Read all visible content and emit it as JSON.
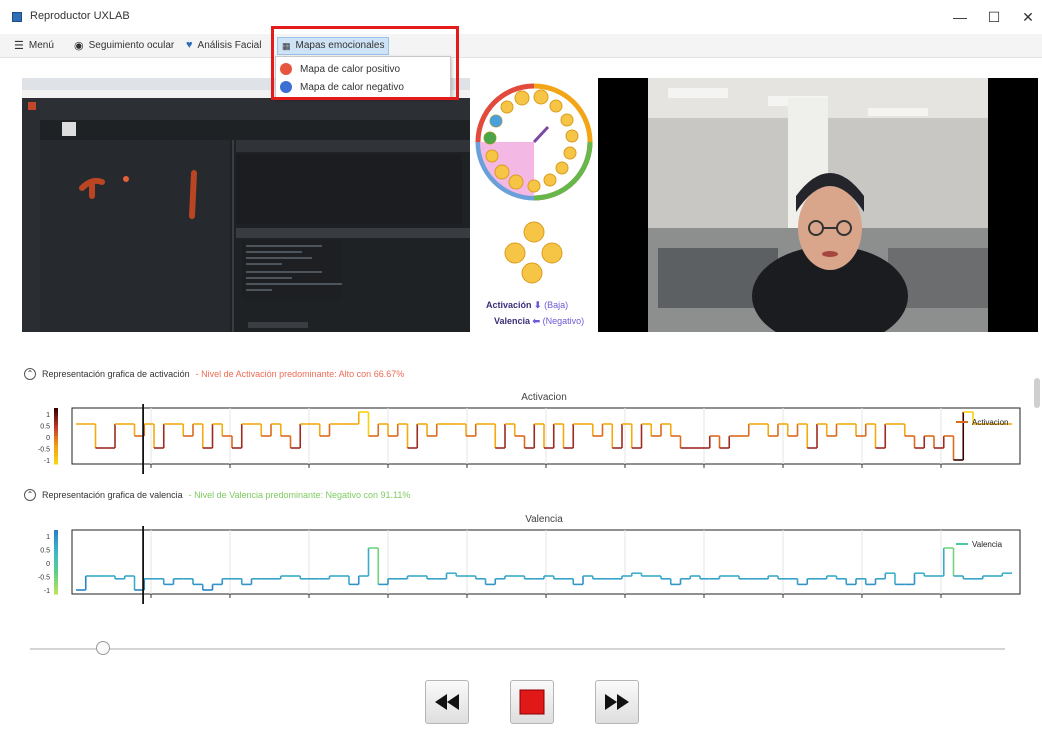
{
  "window": {
    "title": "Reproductor UXLAB",
    "minimize": "—",
    "maximize": "☐",
    "close": "✕"
  },
  "menu": {
    "items": [
      {
        "label": "Menú",
        "icon": "hamburger-icon"
      },
      {
        "label": "Seguimiento ocular",
        "icon": "eye-tracking-icon"
      },
      {
        "label": "Análisis Facial",
        "icon": "heart-icon"
      },
      {
        "label": "Mapas emocionales",
        "icon": "map-grid-icon"
      }
    ],
    "dropdown": [
      {
        "label": "Mapa de calor positivo",
        "color": "#e8553f"
      },
      {
        "label": "Mapa de calor negativo",
        "color": "#3b6fd4"
      }
    ]
  },
  "wheel": {
    "activation_label": "Activación",
    "activation_value": "(Baja)",
    "valence_label": "Valencia",
    "valence_value": "(Negativo)"
  },
  "sections": {
    "activation": {
      "heading": "Representación grafica de activación",
      "subtitle": "- Nivel de Activación predominante: Alto con 66.67%"
    },
    "valence": {
      "heading": "Representación grafica de valencia",
      "subtitle": "- Nivel de Valencia predominante: Negativo con 91.11%"
    }
  },
  "chart_data": [
    {
      "type": "line",
      "title": "Activacion",
      "legend": "Activacion",
      "legend_position": "right",
      "yticks": [
        "1",
        "0.5",
        "0",
        "-0.5",
        "-1"
      ],
      "ylim": [
        -1,
        1
      ],
      "colormap": [
        "#3b0000",
        "#c0392b",
        "#f39c12",
        "#f6d30f"
      ],
      "values": [
        0.5,
        0.5,
        -0.5,
        -0.5,
        0.5,
        0.5,
        0.0,
        0.5,
        -0.5,
        0.5,
        0.5,
        0.0,
        0.5,
        -0.5,
        0.5,
        0.0,
        -0.5,
        0.5,
        0.5,
        0.0,
        0.5,
        0.0,
        -0.5,
        0.5,
        0.5,
        0.0,
        0.5,
        0.5,
        0.5,
        1.0,
        0.0,
        0.5,
        0.0,
        0.5,
        -0.5,
        0.5,
        0.0,
        0.5,
        0.5,
        0.5,
        0.0,
        0.5,
        0.5,
        -0.5,
        0.5,
        0.0,
        -0.5,
        0.5,
        -0.5,
        0.5,
        -0.5,
        0.5,
        0.5,
        0.0,
        0.5,
        -0.5,
        0.5,
        -0.5,
        0.5,
        0.0,
        0.5,
        0.0,
        -0.5,
        -0.5,
        -0.5,
        0.0,
        -0.5,
        0.0,
        0.0,
        0.5,
        0.5,
        0.0,
        0.5,
        0.0,
        0.5,
        -0.5,
        0.5,
        0.0,
        0.5,
        0.5,
        0.0,
        0.5,
        -0.5,
        0.5,
        0.5,
        0.0,
        -0.5,
        0.0,
        -0.5,
        0.0,
        -1.0,
        1.0,
        0.5,
        0.5,
        0.5,
        0.5
      ]
    },
    {
      "type": "line",
      "title": "Valencia",
      "legend": "Valencia",
      "legend_position": "right",
      "yticks": [
        "1",
        "0.5",
        "0",
        "-0.5",
        "-1"
      ],
      "ylim": [
        -1,
        1
      ],
      "colormap": [
        "#2b83c6",
        "#3fb7c9",
        "#59d08a",
        "#b6e35a"
      ],
      "values": [
        -1.0,
        -0.5,
        -0.5,
        -0.5,
        -0.6,
        -0.5,
        -1.0,
        -0.6,
        -0.6,
        -0.8,
        -0.6,
        -0.6,
        -0.8,
        -1.0,
        -0.8,
        -0.6,
        -0.6,
        -0.8,
        -0.6,
        -0.6,
        -0.6,
        -0.5,
        -0.5,
        -0.6,
        -0.6,
        -0.6,
        -0.5,
        -0.5,
        -0.8,
        -0.5,
        0.5,
        -0.8,
        -0.6,
        -0.6,
        -0.5,
        -0.5,
        -0.6,
        -0.6,
        -0.4,
        -0.5,
        -0.5,
        -0.6,
        -0.8,
        -0.6,
        -0.5,
        -0.5,
        -0.6,
        -0.6,
        -0.5,
        -0.6,
        -0.6,
        -0.8,
        -0.5,
        -0.6,
        -0.6,
        -0.6,
        -0.5,
        -0.4,
        -0.5,
        -0.5,
        -0.6,
        -0.8,
        -0.6,
        -0.5,
        -0.6,
        -0.6,
        -0.5,
        -0.5,
        -0.6,
        -0.6,
        -0.6,
        -0.5,
        -0.6,
        -0.6,
        -0.8,
        -0.6,
        -0.6,
        -0.5,
        -0.6,
        -0.8,
        -0.6,
        -0.8,
        -0.6,
        -0.4,
        -0.8,
        -0.8,
        -0.4,
        -0.5,
        -0.5,
        0.5,
        -0.5,
        -0.6,
        -0.6,
        -0.5,
        -0.5,
        -0.4
      ]
    }
  ],
  "player": {
    "rewind": "rewind-icon",
    "stop": "stop-icon",
    "forward": "fast-forward-icon",
    "position": 0.075
  }
}
